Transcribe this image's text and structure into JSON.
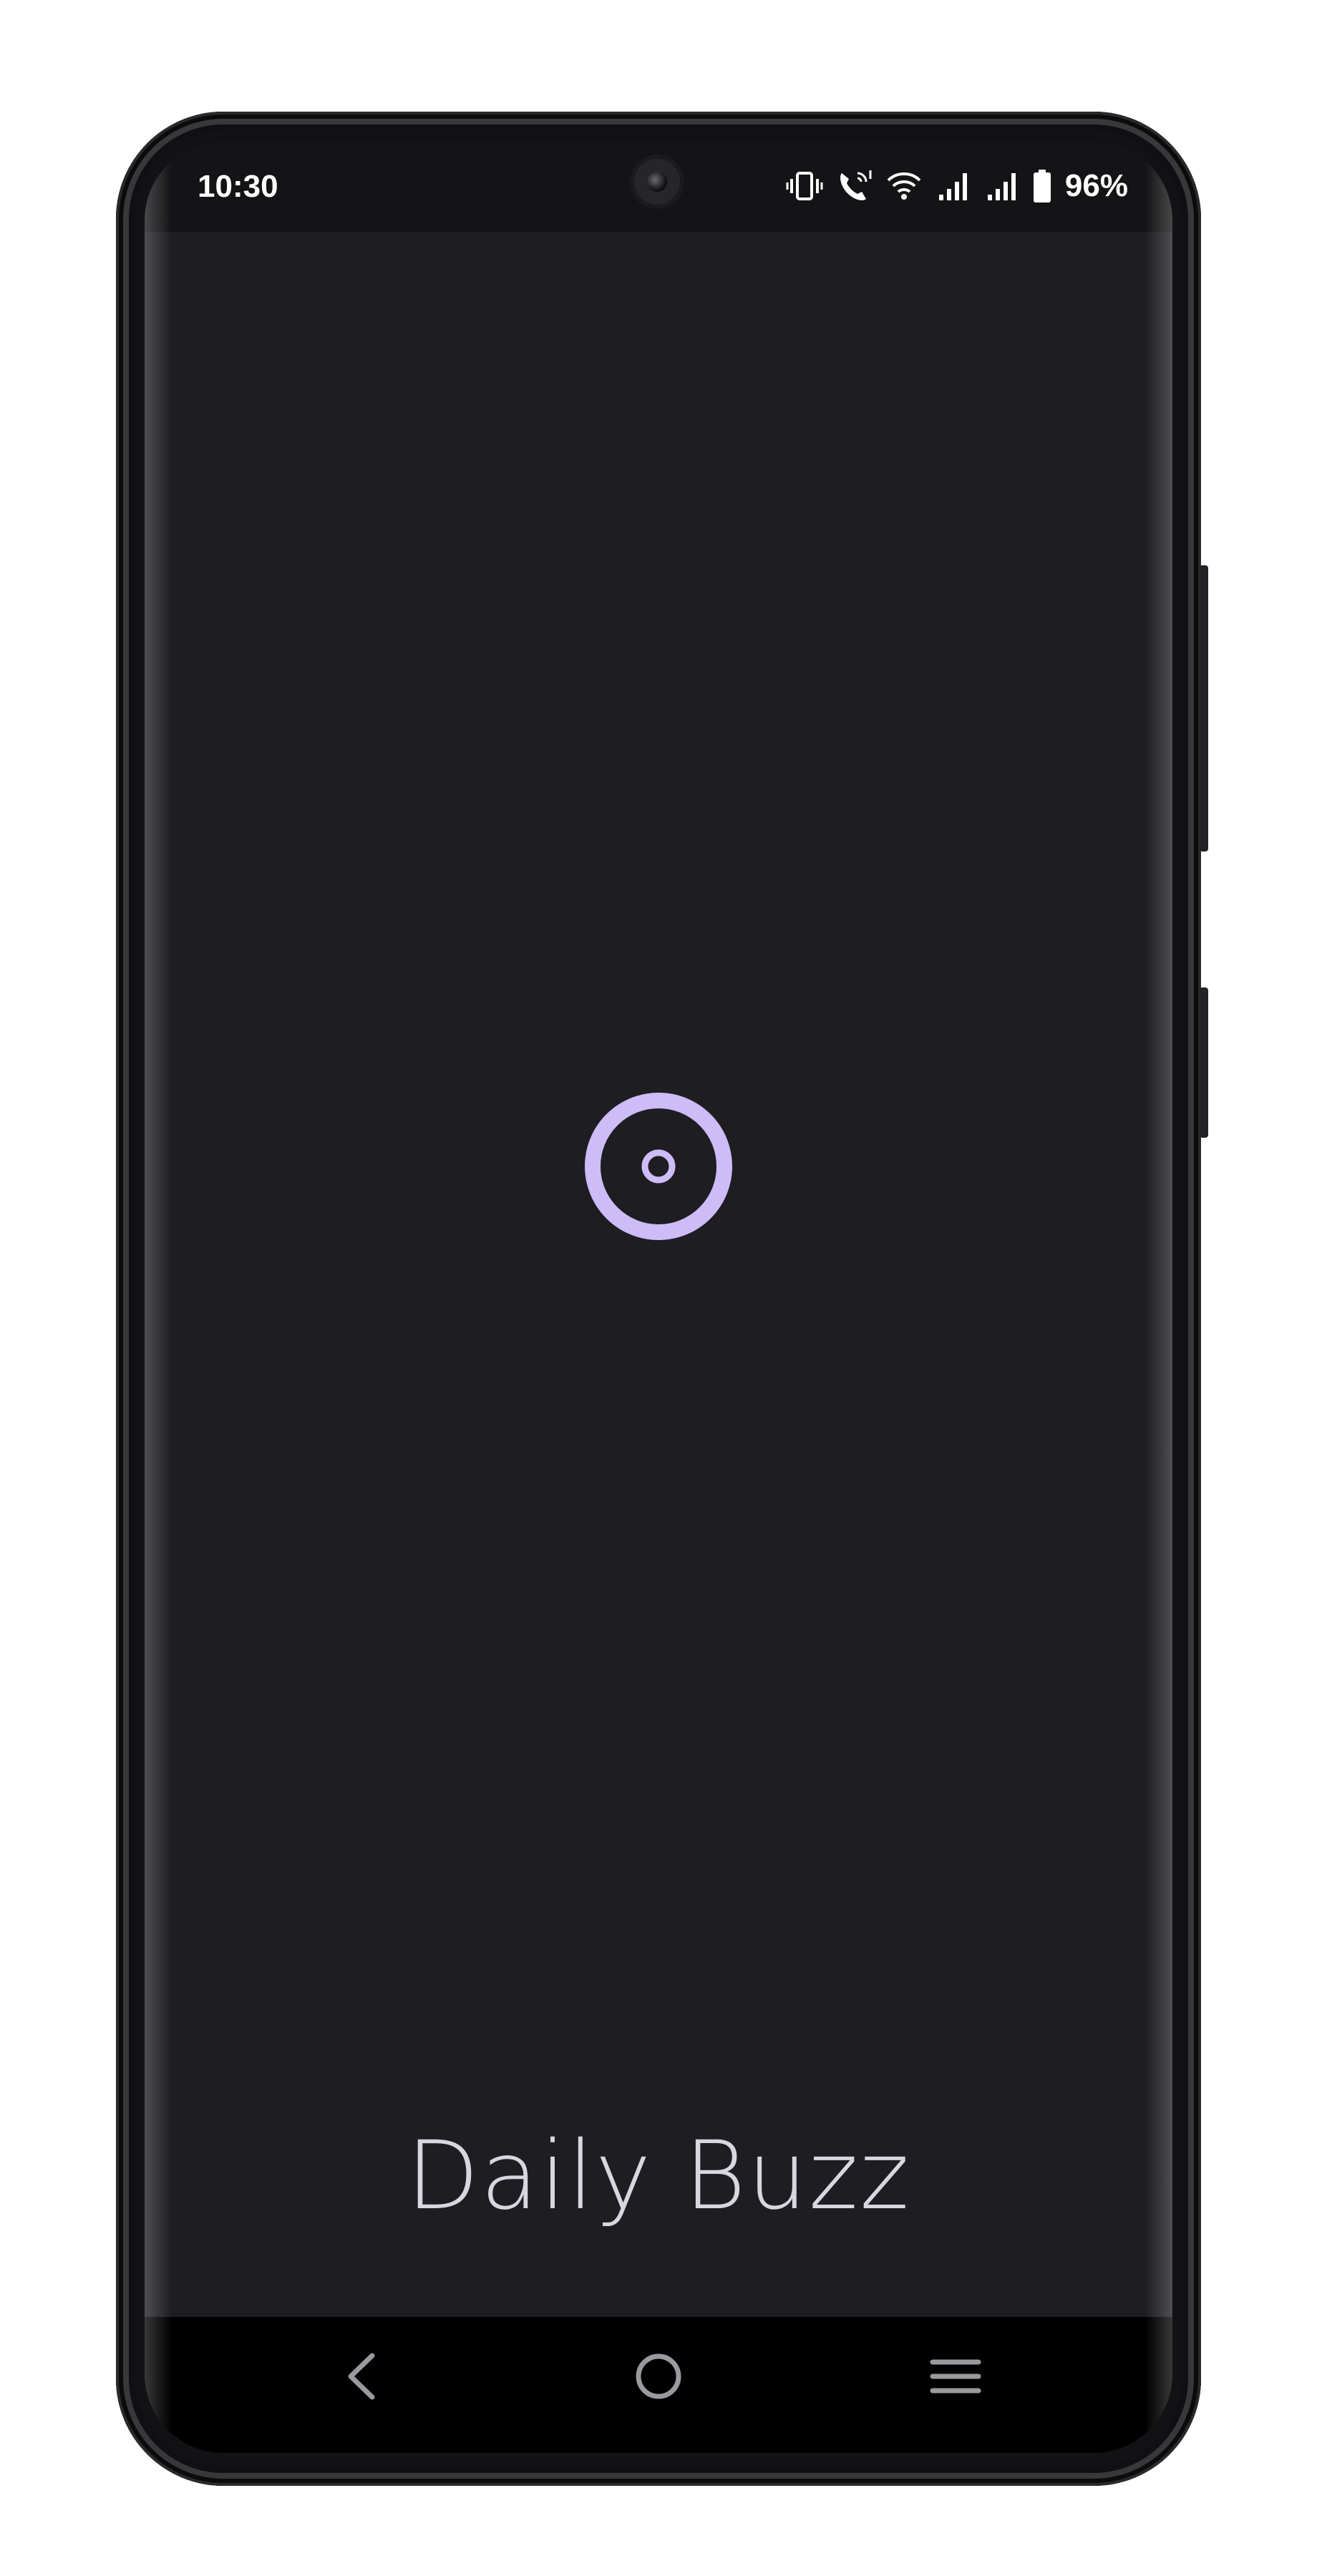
{
  "status_bar": {
    "time": "10:30",
    "battery_percent": "96%",
    "icons": [
      "vibrate-icon",
      "wifi-calling-icon",
      "wifi-icon",
      "signal-icon",
      "signal-icon",
      "battery-icon"
    ]
  },
  "splash": {
    "logo_icon": "radio-target-icon",
    "app_name": "Daily Buzz",
    "accent_color": "#cdbcf7",
    "background_color": "#1e1d22"
  },
  "nav_bar": {
    "buttons": [
      "back-icon",
      "home-icon",
      "recents-icon"
    ]
  }
}
